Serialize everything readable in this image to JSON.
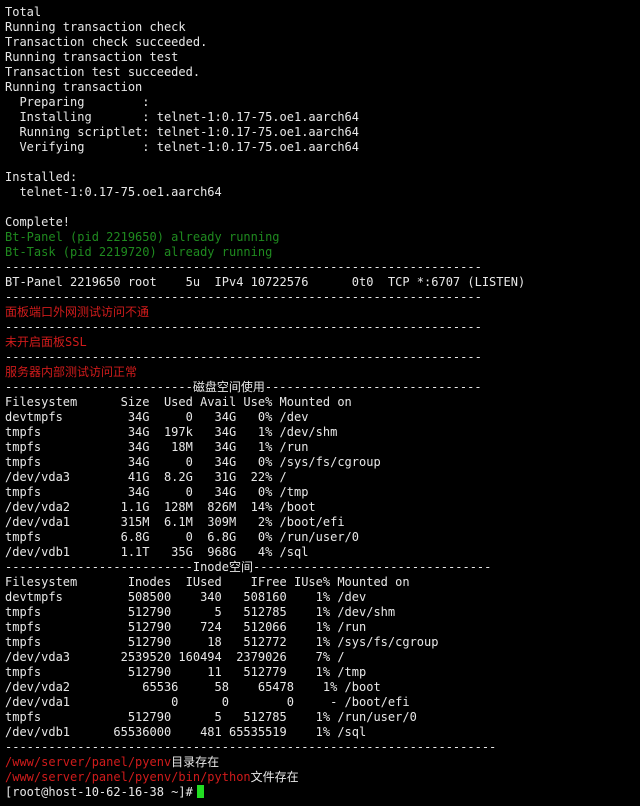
{
  "terminal": {
    "colors": {
      "background": "#000000",
      "text": "#e8e8e8",
      "green": "#1f8a1f",
      "red": "#d01b1b",
      "cursor": "#22dd22"
    },
    "lines": [
      {
        "text": "Total",
        "color": "white"
      },
      {
        "text": "Running transaction check",
        "color": "white"
      },
      {
        "text": "Transaction check succeeded.",
        "color": "white"
      },
      {
        "text": "Running transaction test",
        "color": "white"
      },
      {
        "text": "Transaction test succeeded.",
        "color": "white"
      },
      {
        "text": "Running transaction",
        "color": "white"
      },
      {
        "text": "  Preparing        :",
        "color": "white"
      },
      {
        "text": "  Installing       : telnet-1:0.17-75.oe1.aarch64",
        "color": "white"
      },
      {
        "text": "  Running scriptlet: telnet-1:0.17-75.oe1.aarch64",
        "color": "white"
      },
      {
        "text": "  Verifying        : telnet-1:0.17-75.oe1.aarch64",
        "color": "white"
      },
      {
        "text": "",
        "color": "white"
      },
      {
        "text": "Installed:",
        "color": "white"
      },
      {
        "text": "  telnet-1:0.17-75.oe1.aarch64",
        "color": "white"
      },
      {
        "text": "",
        "color": "white"
      },
      {
        "text": "Complete!",
        "color": "white"
      },
      {
        "text": "Bt-Panel (pid 2219650) already running",
        "color": "green"
      },
      {
        "text": "Bt-Task (pid 2219720) already running",
        "color": "green"
      },
      {
        "text": "------------------------------------------------------------------",
        "color": "white"
      },
      {
        "text": "BT-Panel 2219650 root    5u  IPv4 10722576      0t0  TCP *:6707 (LISTEN)",
        "color": "white"
      },
      {
        "text": "------------------------------------------------------------------",
        "color": "white"
      },
      {
        "text": "面板端口外网测试访问不通",
        "color": "red"
      },
      {
        "text": "------------------------------------------------------------------",
        "color": "white"
      },
      {
        "text": "未开启面板SSL",
        "color": "red"
      },
      {
        "text": "------------------------------------------------------------------",
        "color": "white"
      },
      {
        "text": "服务器内部测试访问正常",
        "color": "red"
      },
      {
        "text": "--------------------------磁盘空间使用------------------------------",
        "color": "white"
      },
      {
        "text": "Filesystem      Size  Used Avail Use% Mounted on",
        "color": "white"
      },
      {
        "text": "devtmpfs         34G     0   34G   0% /dev",
        "color": "white"
      },
      {
        "text": "tmpfs            34G  197k   34G   1% /dev/shm",
        "color": "white"
      },
      {
        "text": "tmpfs            34G   18M   34G   1% /run",
        "color": "white"
      },
      {
        "text": "tmpfs            34G     0   34G   0% /sys/fs/cgroup",
        "color": "white"
      },
      {
        "text": "/dev/vda3        41G  8.2G   31G  22% /",
        "color": "white"
      },
      {
        "text": "tmpfs            34G     0   34G   0% /tmp",
        "color": "white"
      },
      {
        "text": "/dev/vda2       1.1G  128M  826M  14% /boot",
        "color": "white"
      },
      {
        "text": "/dev/vda1       315M  6.1M  309M   2% /boot/efi",
        "color": "white"
      },
      {
        "text": "tmpfs           6.8G     0  6.8G   0% /run/user/0",
        "color": "white"
      },
      {
        "text": "/dev/vdb1       1.1T   35G  968G   4% /sql",
        "color": "white"
      },
      {
        "text": "--------------------------Inode空间---------------------------------",
        "color": "white"
      },
      {
        "text": "Filesystem       Inodes  IUsed    IFree IUse% Mounted on",
        "color": "white"
      },
      {
        "text": "devtmpfs         508500    340   508160    1% /dev",
        "color": "white"
      },
      {
        "text": "tmpfs            512790      5   512785    1% /dev/shm",
        "color": "white"
      },
      {
        "text": "tmpfs            512790    724   512066    1% /run",
        "color": "white"
      },
      {
        "text": "tmpfs            512790     18   512772    1% /sys/fs/cgroup",
        "color": "white"
      },
      {
        "text": "/dev/vda3       2539520 160494  2379026    7% /",
        "color": "white"
      },
      {
        "text": "tmpfs            512790     11   512779    1% /tmp",
        "color": "white"
      },
      {
        "text": "/dev/vda2          65536     58    65478    1% /boot",
        "color": "white"
      },
      {
        "text": "/dev/vda1              0      0        0     - /boot/efi",
        "color": "white"
      },
      {
        "text": "tmpfs            512790      5   512785    1% /run/user/0",
        "color": "white"
      },
      {
        "text": "/dev/vdb1      65536000    481 65535519    1% /sql",
        "color": "white"
      },
      {
        "text": "--------------------------------------------------------------------",
        "color": "white"
      }
    ],
    "pyenv_dir": {
      "path": "/www/server/panel/pyenv",
      "suffix": "目录存在"
    },
    "python_file": {
      "path": "/www/server/panel/pyenv/bin/python",
      "suffix": "文件存在"
    },
    "prompt": "[root@host-10-62-16-38 ~]#"
  }
}
